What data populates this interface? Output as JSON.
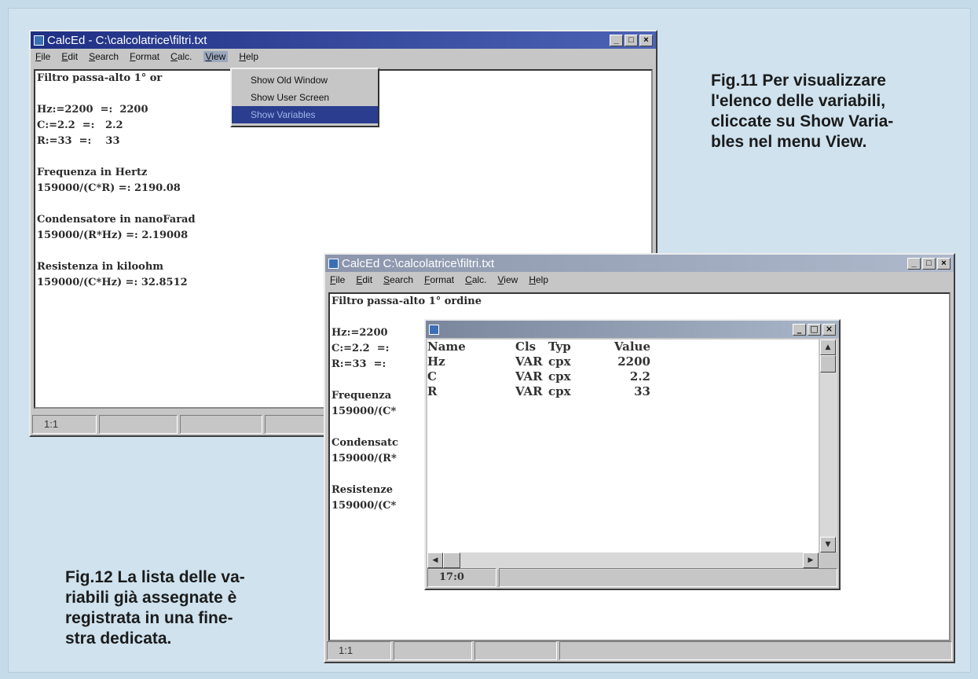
{
  "fig11": {
    "caption": "Fig.11 Per visualizzare l'elenco delle variabili, cliccate su Show Variables nel menu View.",
    "caption_lines": [
      "Fig.11 Per visualizzare",
      "l'elenco delle variabili,",
      "cliccate su Show Varia-",
      "bles nel menu View."
    ],
    "window": {
      "title": "CalcEd  -  C:\\calcolatrice\\filtri.txt",
      "menu": [
        "File",
        "Edit",
        "Search",
        "Format",
        "Calc.",
        "View",
        "Help"
      ],
      "view_menu": {
        "items": [
          "Show Old Window",
          "Show User Screen",
          "Show Variables"
        ],
        "selected": "Show Variables"
      },
      "lines": [
        "Filtro passa-alto 1° or",
        "",
        "Hz:=2200  =:  2200",
        "C:=2.2  =:   2.2",
        "R:=33  =:    33",
        "",
        "Frequenza in Hertz",
        "159000/(C*R) =: 2190.08",
        "",
        "Condensatore in nanoFarad",
        "159000/(R*Hz) =: 2.19008",
        "",
        "Resistenza in kiloohm",
        "159000/(C*Hz) =: 32.8512"
      ],
      "status": "1:1"
    }
  },
  "fig12": {
    "caption_lines": [
      "Fig.12 La lista delle va-",
      "riabili già assegnate è",
      "registrata in una fine-",
      "stra dedicata."
    ],
    "window": {
      "title": "CalcEd   C:\\calcolatrice\\filtri.txt",
      "menu": [
        "File",
        "Edit",
        "Search",
        "Format",
        "Calc.",
        "View",
        "Help"
      ],
      "lines": [
        "Filtro passa-alto 1° ordine",
        "",
        "Hz:=2200",
        "C:=2.2  =:",
        "R:=33  =:",
        "",
        "Frequenza",
        "159000/(C*",
        "",
        "Condensatc",
        "159000/(R*",
        "",
        "Resistenze",
        "159000/(C*"
      ],
      "status": "1:1"
    },
    "variables_window": {
      "headers": [
        "Name",
        "Cls",
        "Typ",
        "Value"
      ],
      "rows": [
        [
          "Hz",
          "VAR",
          "cpx",
          "2200"
        ],
        [
          "C",
          "VAR",
          "cpx",
          "2.2"
        ],
        [
          "R",
          "VAR",
          "cpx",
          "33"
        ]
      ],
      "status": "17:0"
    }
  },
  "colors": {
    "titlebar_active": "#1f2f84",
    "page_bg": "#cfe2ee",
    "menu_selected": "#2b3d8f"
  }
}
